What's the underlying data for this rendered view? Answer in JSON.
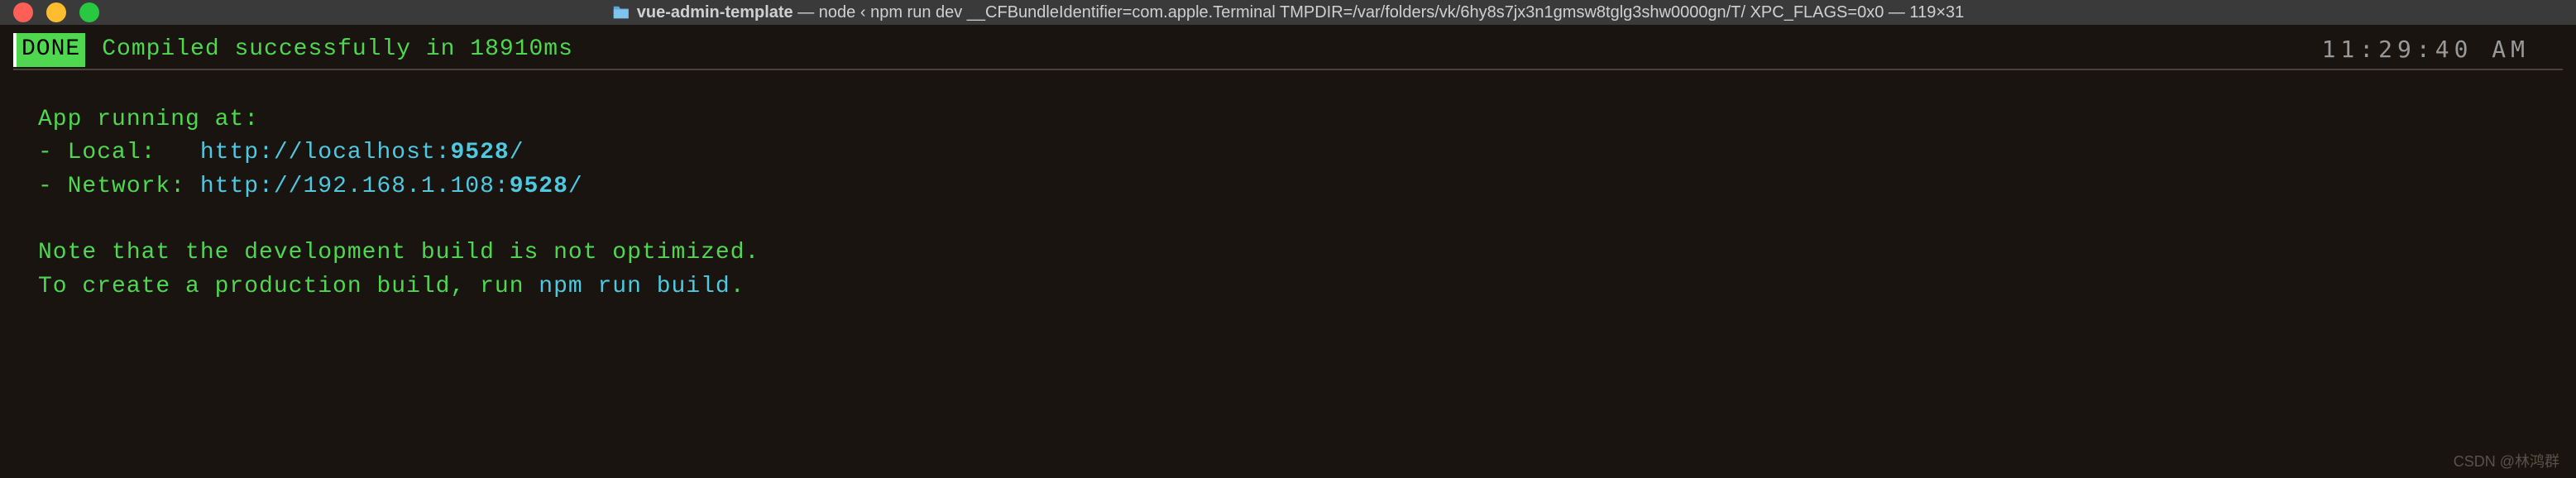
{
  "titlebar": {
    "folder_name": "vue-admin-template",
    "title_rest": " — node ‹ npm run dev __CFBundleIdentifier=com.apple.Terminal TMPDIR=/var/folders/vk/6hy8s7jx3n1gmsw8tglg3shw0000gn/T/ XPC_FLAGS=0x0 — 119×31"
  },
  "status": {
    "done_label": " DONE ",
    "compiled_text": "Compiled successfully in 18910ms",
    "timestamp": "11:29:40 AM"
  },
  "app_info": {
    "running_label": "App running at:",
    "local_label": "- Local:   ",
    "local_url_prefix": "http://localhost:",
    "local_port": "9528",
    "local_url_suffix": "/",
    "network_label": "- Network: ",
    "network_url_prefix": "http://192.168.1.108:",
    "network_port": "9528",
    "network_url_suffix": "/"
  },
  "notes": {
    "line1": "Note that the development build is not optimized.",
    "line2_prefix": "To create a production build, run ",
    "line2_cmd": "npm run build",
    "line2_suffix": "."
  },
  "watermark": "CSDN @林鸿群"
}
